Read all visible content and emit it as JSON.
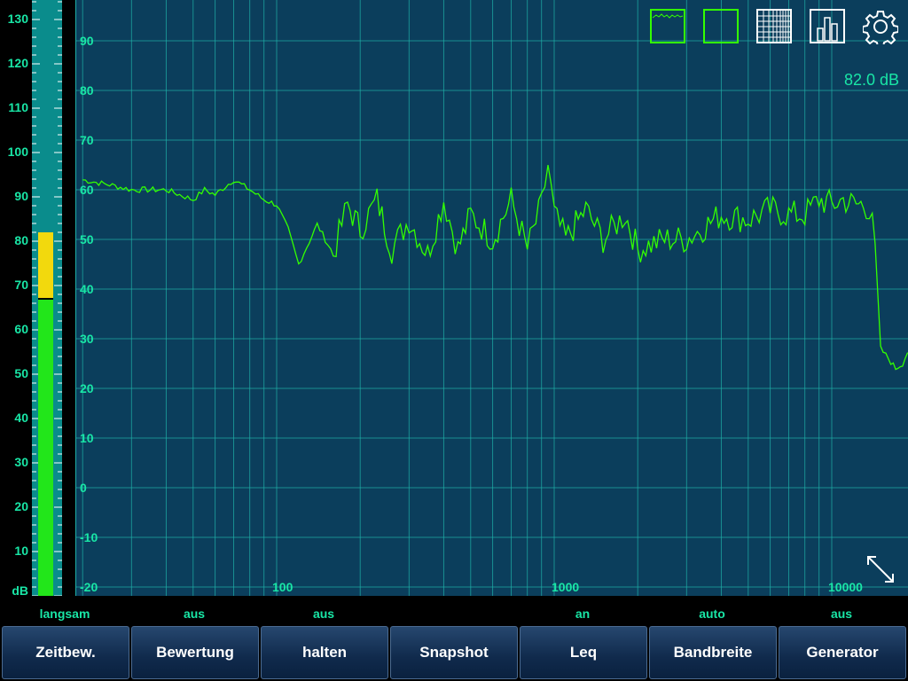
{
  "meter": {
    "unit_label": "dB",
    "ticks": [
      "130",
      "120",
      "110",
      "100",
      "90",
      "80",
      "70",
      "60",
      "50",
      "40",
      "30",
      "20",
      "10"
    ],
    "level": 82.0,
    "peak_color": "#f2d90d",
    "bar_color": "#22e61a"
  },
  "spectrum": {
    "readout": "82.0 dB",
    "y_ticks": [
      "90",
      "80",
      "70",
      "60",
      "50",
      "40",
      "30",
      "20",
      "10",
      "0",
      "-10",
      "-20"
    ],
    "x_ticks": [
      "100",
      "1000",
      "10000"
    ],
    "trace_color": "#33ff00",
    "grid_color": "#1fb0a8",
    "background": "#0b3e5c"
  },
  "chart_data": {
    "type": "line",
    "x_scale": "log",
    "ylim": [
      -20,
      90
    ],
    "xlim": [
      20,
      20000
    ],
    "x_ticks": [
      100,
      1000,
      10000
    ],
    "y_ticks": [
      90,
      80,
      70,
      60,
      50,
      40,
      30,
      20,
      10,
      0,
      -10,
      -20
    ],
    "grid": true,
    "series": [
      {
        "x": [
          20,
          25,
          30,
          40,
          50,
          55,
          60,
          70,
          80,
          90,
          100,
          110,
          120,
          140,
          160,
          180,
          200,
          230,
          260,
          300,
          350,
          400,
          450,
          500,
          600,
          700,
          800,
          900,
          950,
          1000,
          1100,
          1300,
          1500,
          1800,
          2000,
          2500,
          3000,
          4000,
          5000,
          6000,
          7000,
          8000,
          9000,
          10000,
          11000,
          12000,
          13000,
          14000,
          15000,
          16000,
          17000,
          18000,
          20000
        ],
        "y": [
          62,
          61,
          60,
          60,
          58,
          60,
          59,
          62,
          60,
          58,
          57,
          52,
          45,
          53,
          47,
          57,
          52,
          58,
          48,
          54,
          47,
          58,
          48,
          55,
          50,
          58,
          48,
          57,
          65,
          55,
          50,
          56,
          50,
          55,
          48,
          50,
          50,
          55,
          54,
          56,
          55,
          55,
          58,
          57,
          58,
          57,
          57,
          56,
          28,
          26,
          24,
          25,
          31
        ]
      }
    ]
  },
  "view_buttons": [
    {
      "name": "spectrum-view-icon"
    },
    {
      "name": "blank-view-icon"
    },
    {
      "name": "grid-view-icon"
    },
    {
      "name": "bar-view-icon"
    },
    {
      "name": "gear-icon"
    }
  ],
  "toolbar": {
    "buttons": [
      {
        "label": "Zeitbew.",
        "status": "langsam"
      },
      {
        "label": "Bewertung",
        "status": "aus"
      },
      {
        "label": "halten",
        "status": "aus"
      },
      {
        "label": "Snapshot",
        "status": ""
      },
      {
        "label": "Leq",
        "status": "an"
      },
      {
        "label": "Bandbreite",
        "status": "auto"
      },
      {
        "label": "Generator",
        "status": "aus"
      }
    ]
  }
}
